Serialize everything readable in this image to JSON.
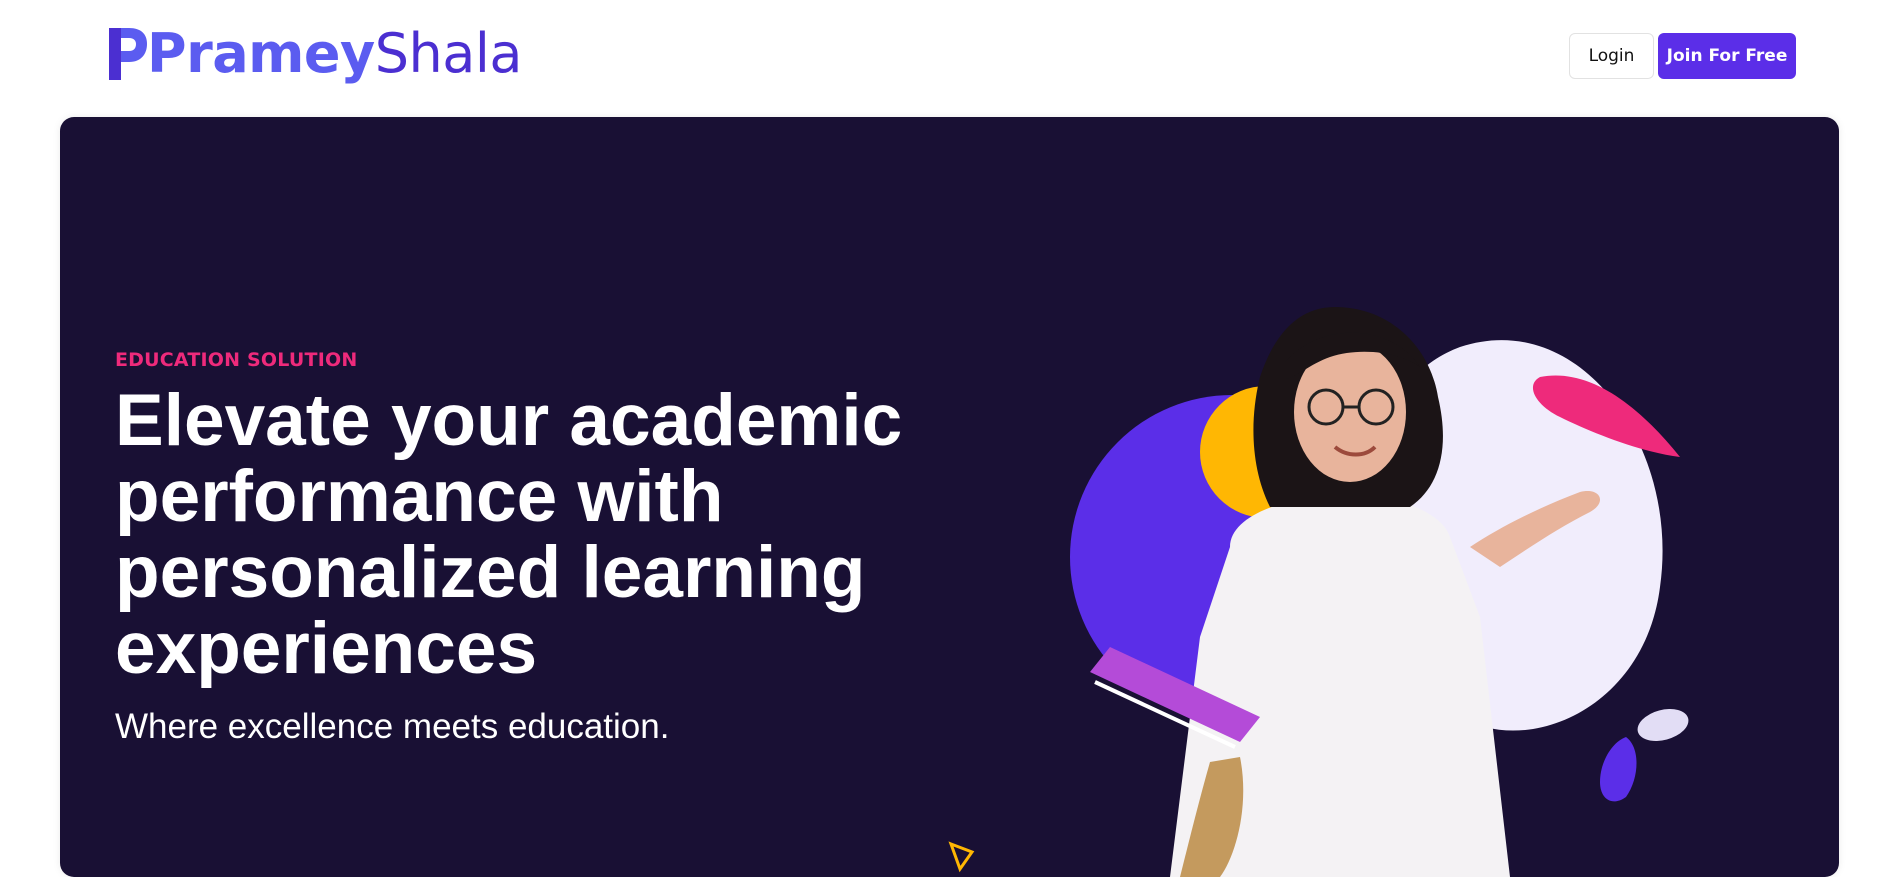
{
  "header": {
    "logo": {
      "part1": "Pramey",
      "part2": "Shala"
    },
    "login_label": "Login",
    "join_label": "Join For Free"
  },
  "hero": {
    "eyebrow": "EDUCATION SOLUTION",
    "headline": "Elevate your academic performance with personalized learning experiences",
    "subline": "Where excellence meets education."
  },
  "colors": {
    "brand_purple": "#5b2ee8",
    "hero_background": "#191034",
    "accent_pink": "#ee2a7b",
    "accent_yellow": "#ffb703",
    "logo_light": "#5b5cf0",
    "logo_dark": "#4b2fd1"
  },
  "icons": [
    "logo-mark-icon",
    "triangle-outline-icon"
  ]
}
